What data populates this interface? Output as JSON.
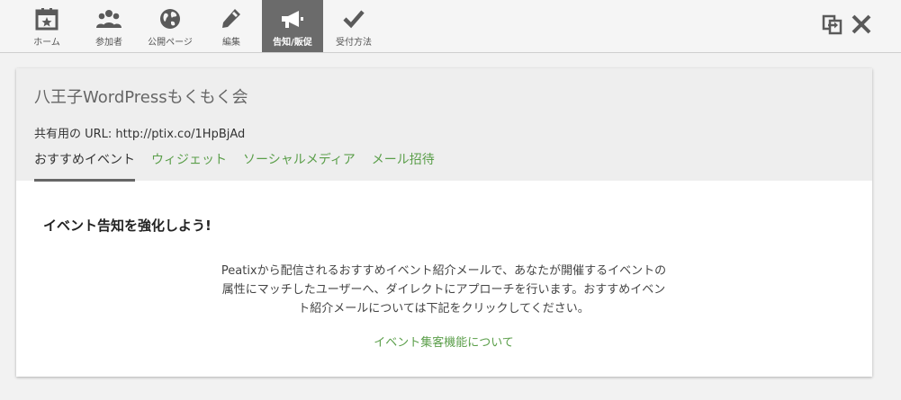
{
  "nav": {
    "items": [
      {
        "label": "ホーム",
        "icon": "calendar-star-icon"
      },
      {
        "label": "参加者",
        "icon": "users-icon"
      },
      {
        "label": "公開ページ",
        "icon": "globe-icon"
      },
      {
        "label": "編集",
        "icon": "pencil-icon"
      },
      {
        "label": "告知/販促",
        "icon": "megaphone-icon",
        "active": true
      },
      {
        "label": "受付方法",
        "icon": "checkmark-icon"
      }
    ]
  },
  "window_controls": {
    "switch_icon": "switch-window-icon",
    "close_icon": "close-icon"
  },
  "event": {
    "title": "八王子WordPressもくもく会",
    "share_url_label": "共有用の URL: http://ptix.co/1HpBjAd"
  },
  "tabs": [
    {
      "label": "おすすめイベント",
      "active": true
    },
    {
      "label": "ウィジェット"
    },
    {
      "label": "ソーシャルメディア"
    },
    {
      "label": "メール招待"
    }
  ],
  "promo": {
    "heading": "イベント告知を強化しよう!",
    "description": "Peatixから配信されるおすすめイベント紹介メールで、あなたが開催するイベントの属性にマッチしたユーザーへ、ダイレクトにアプローチを行います。おすすめイベント紹介メールについては下記をクリックしてください。",
    "link": "イベント集客機能について"
  },
  "colors": {
    "accent_green": "#5a9e49",
    "active_nav": "#6b6b6b"
  }
}
